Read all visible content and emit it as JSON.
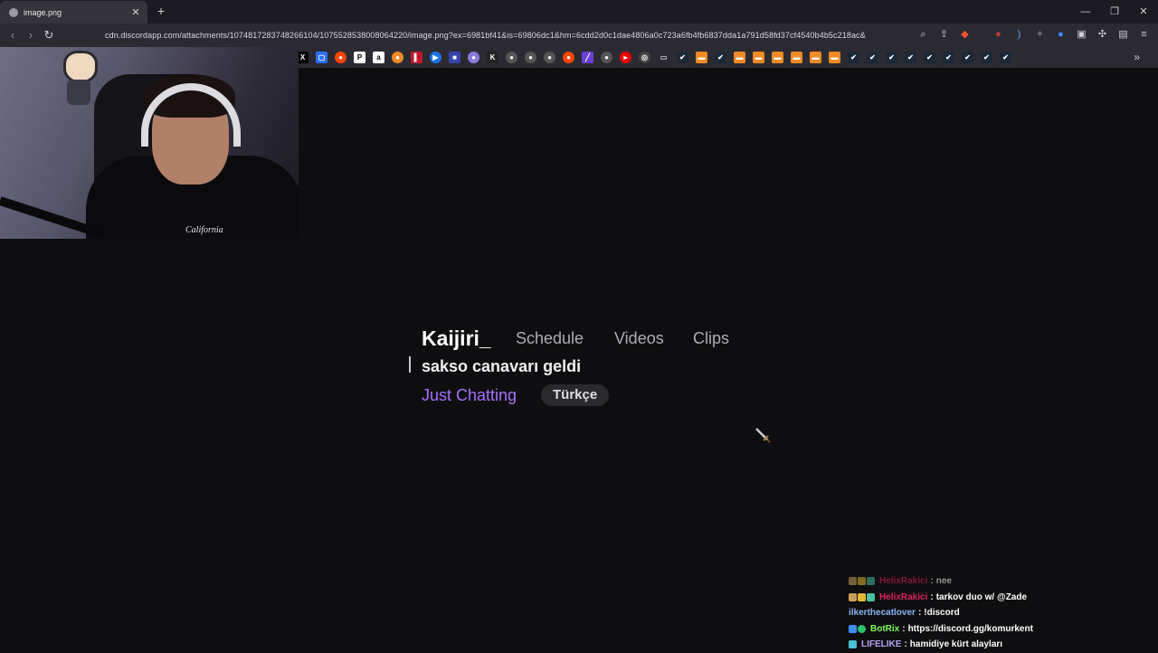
{
  "browser": {
    "tab_title": "image.png",
    "url": "cdn.discordapp.com/attachments/1074817283748266104/1075528538008064220/image.png?ex=6981bf41&is=69806dc1&hm=6cdd2d0c1dae4806a0c723a6fb4fb6837dda1a791d58fd37cf4540b4b5c218ac&",
    "new_tab_label": "+",
    "tab_close_label": "✕"
  },
  "webcam": {
    "shirt_text": "California"
  },
  "channel": {
    "name": "Kaijiri_",
    "nav": {
      "schedule": "Schedule",
      "videos": "Videos",
      "clips": "Clips"
    },
    "stream_title": "sakso canavarı geldi",
    "category": "Just Chatting",
    "tag": "Türkçe"
  },
  "chat": {
    "messages": [
      {
        "user": "HelixRakici",
        "text": "nee",
        "user_color": "#e0245e",
        "badges": [
          "#c8a25a",
          "#e8b730",
          "#49c0a0"
        ]
      },
      {
        "user": "HelixRakici",
        "text": "tarkov duo w/ @Zade",
        "user_color": "#e0245e",
        "badges": [
          "#c8a25a",
          "#e8b730",
          "#49c0a0"
        ]
      },
      {
        "user": "ilkerthecatlover",
        "text": "!discord",
        "user_color": "#8ab4f8",
        "badges": []
      },
      {
        "user": "BotRix",
        "text": "https://discord.gg/komurkent",
        "user_color": "#7cfc5a",
        "badges": [
          "#3b8ff0",
          "#25c46a"
        ]
      },
      {
        "user": "LIFELIKE",
        "text": "hamidiye kürt alayları",
        "user_color": "#b9a4ff",
        "badges": [
          "#49c0d0"
        ]
      }
    ]
  }
}
